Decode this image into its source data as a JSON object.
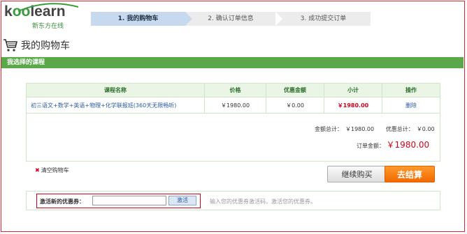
{
  "logo": {
    "brand_pre": "k",
    "brand_oo": "oo",
    "brand_post": "learn",
    "subtitle": "新东方在线"
  },
  "steps": [
    {
      "label": "1. 我的购物车"
    },
    {
      "label": "2. 确认订单信息"
    },
    {
      "label": "3. 成功提交订单"
    }
  ],
  "page": {
    "title": "我的购物车",
    "section": "我选择的课程"
  },
  "table": {
    "headers": [
      "课程名称",
      "价格",
      "优惠金额",
      "小计",
      "操作"
    ],
    "rows": [
      {
        "name": "初三语文+数学+英语+物理+化学联报班(360天无限畅听)",
        "price": "￥1980.00",
        "discount": "￥0.00",
        "subtotal": "￥1980.00",
        "action": "删除"
      }
    ]
  },
  "totals": {
    "amount_label": "金额总计：",
    "amount": "￥1980.00",
    "discount_label": "优惠总计：",
    "discount": "￥0.00",
    "order_label": "订单金额：",
    "order_amount": "￥1980.00"
  },
  "actions": {
    "clear": "清空购物车",
    "continue": "继续购买",
    "checkout": "去结算"
  },
  "coupon": {
    "label": "激活新的优惠券：",
    "value": "",
    "button": "激活",
    "hint": "输入您的优惠券激活码，激活您的优惠券。"
  },
  "colors": {
    "green": "#5aa84a",
    "red": "#d0021b",
    "orange": "#f06a00"
  }
}
